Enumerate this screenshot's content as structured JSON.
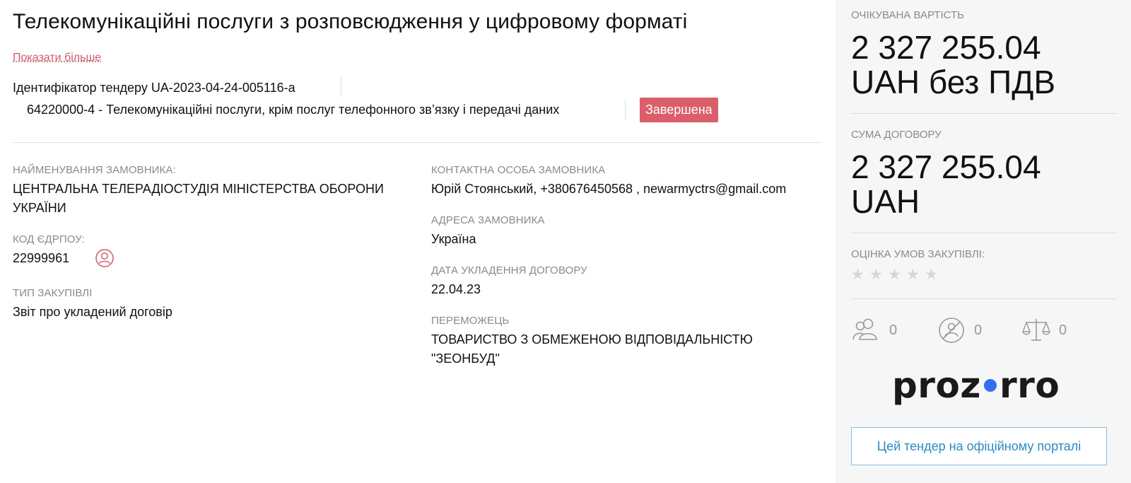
{
  "tender": {
    "title": "Телекомунікаційні послуги з розповсюдження у цифровому форматі",
    "show_more": "Показати більше",
    "tender_id": "Ідентифікатор тендеру UA-2023-04-24-005116-a",
    "cpv": "64220000-4 - Телекомунікаційні послуги, крім послуг телефонного зв’язку і передачі даних",
    "status": "Завершена"
  },
  "fields": {
    "customer_name_label": "НАЙМЕНУВАННЯ ЗАМОВНИКА:",
    "customer_name_value": "ЦЕНТРАЛЬНА ТЕЛЕРАДІОСТУДІЯ МІНІСТЕРСТВА ОБОРОНИ УКРАЇНИ",
    "edrpou_label": "КОД ЄДРПОУ:",
    "edrpou_value": "22999961",
    "procurement_type_label": "ТИП ЗАКУПІВЛІ",
    "procurement_type_value": "Звіт про укладений договір",
    "contact_label": "КОНТАКТНА ОСОБА ЗАМОВНИКА",
    "contact_value": "Юрій Стоянський, +380676450568 , newarmyctrs@gmail.com",
    "address_label": "АДРЕСА ЗАМОВНИКА",
    "address_value": "Україна",
    "contract_date_label": "ДАТА УКЛАДЕННЯ ДОГОВОРУ",
    "contract_date_value": "22.04.23",
    "winner_label": "ПЕРЕМОЖЕЦЬ",
    "winner_value": "ТОВАРИСТВО З ОБМЕЖЕНОЮ ВІДПОВІДАЛЬНІСТЮ \"ЗЕОНБУД\""
  },
  "sidebar": {
    "expected_label": "ОЧІКУВАНА ВАРТІСТЬ",
    "expected_amount_line1": "2 327 255.04",
    "expected_amount_line2": "UAH без ПДВ",
    "contract_sum_label": "СУМА ДОГОВОРУ",
    "contract_sum_line1": "2 327 255.04",
    "contract_sum_line2": "UAH",
    "rating_label": "ОЦІНКА УМОВ ЗАКУПІВЛІ:",
    "rating_value": 0,
    "rating_max": 5,
    "counters": {
      "participants": "0",
      "disqualified": "0",
      "complaints": "0"
    },
    "logo_text": "prozorro",
    "portal_button": "Цей тендер на офіційному порталі"
  },
  "colors": {
    "accent_red": "#da5f6b",
    "link_pink": "#d05a6a",
    "portal_blue": "#2c8bc6",
    "logo_dot": "#2f6ff0"
  }
}
